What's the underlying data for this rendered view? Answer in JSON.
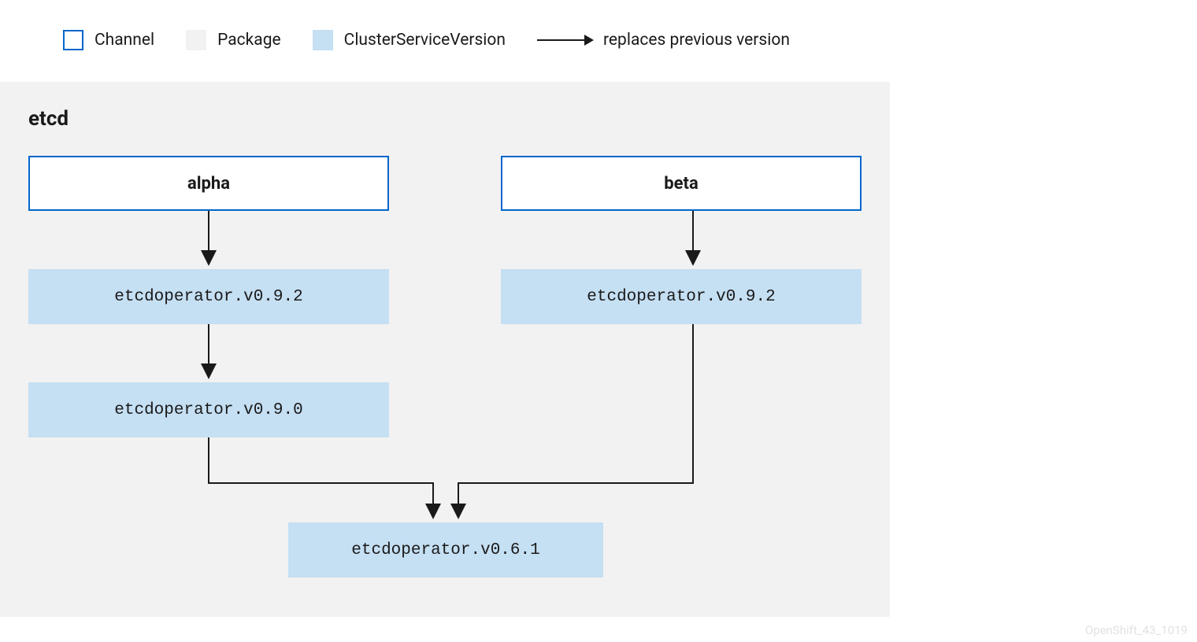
{
  "legend": {
    "channel": "Channel",
    "package": "Package",
    "csv": "ClusterServiceVersion",
    "replaces": "replaces previous version"
  },
  "package_name": "etcd",
  "channels": {
    "alpha": {
      "label": "alpha",
      "csv1": "etcdoperator.v0.9.2",
      "csv2": "etcdoperator.v0.9.0"
    },
    "beta": {
      "label": "beta",
      "csv1": "etcdoperator.v0.9.2"
    }
  },
  "shared_csv": "etcdoperator.v0.6.1",
  "watermark": "OpenShift_43_1019"
}
